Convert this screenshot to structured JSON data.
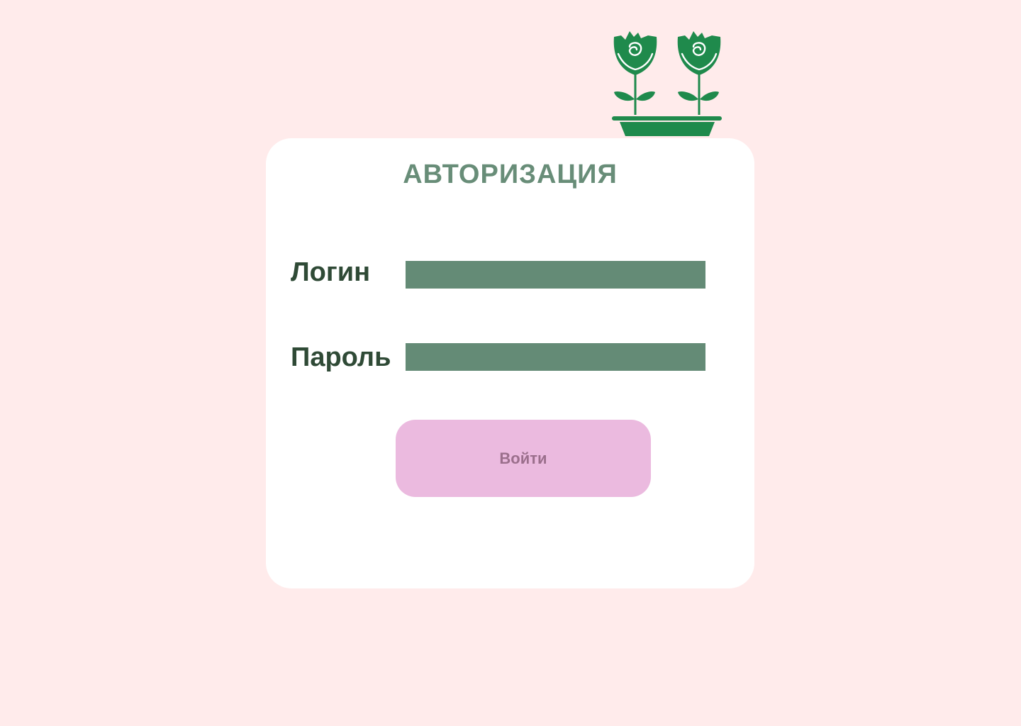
{
  "colors": {
    "background": "#ffebeb",
    "card": "#ffffff",
    "title": "#688d78",
    "label": "#2f4a36",
    "input": "#648b76",
    "button": "#ebbadf",
    "button_text": "#9b6f8c",
    "decor": "#1f8a4c"
  },
  "decor": {
    "icon": "potted-roses-icon"
  },
  "auth": {
    "title": "АВТОРИЗАЦИЯ",
    "login_label": "Логин",
    "login_value": "",
    "password_label": "Пароль",
    "password_value": "",
    "submit_label": "Войти"
  }
}
